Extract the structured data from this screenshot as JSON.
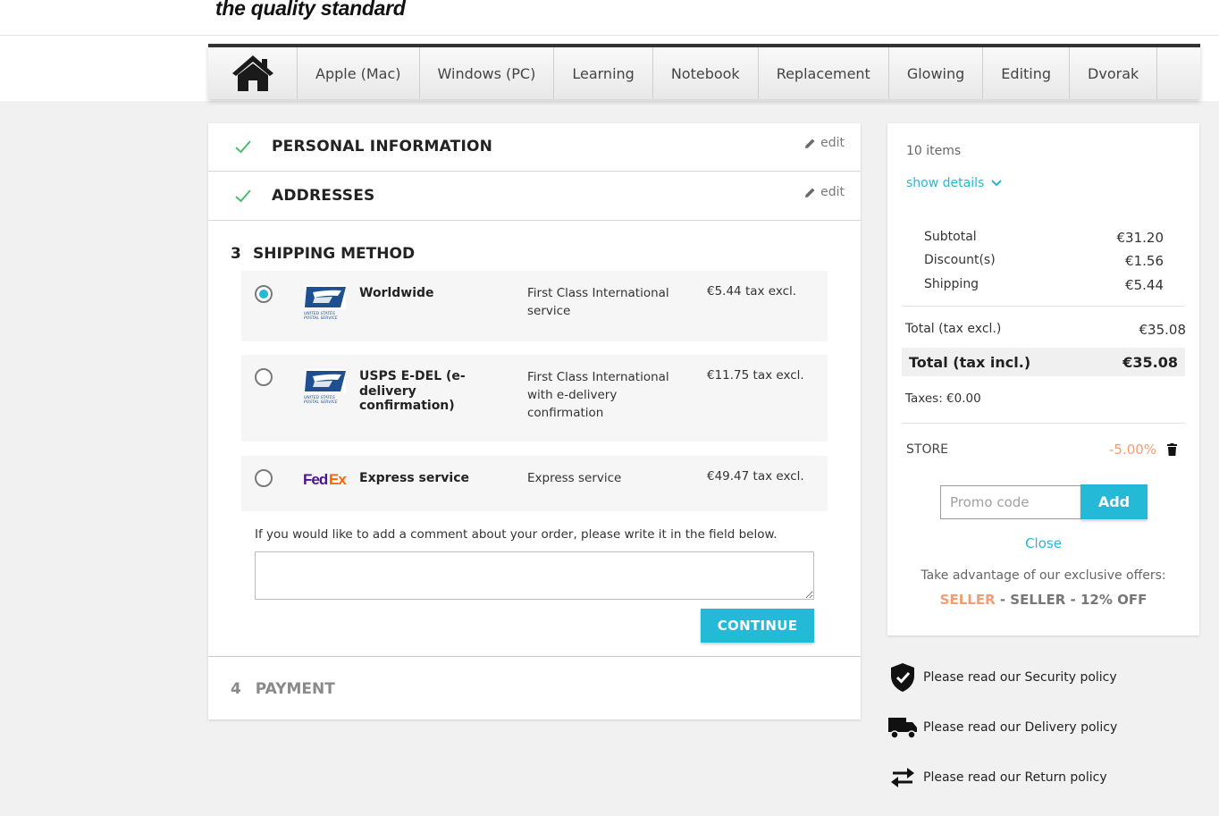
{
  "header": {
    "tagline": "the quality standard"
  },
  "nav": {
    "home_icon": "home-icon",
    "items": [
      "Apple (Mac)",
      "Windows (PC)",
      "Learning",
      "Notebook",
      "Replacement",
      "Glowing",
      "Editing",
      "Dvorak"
    ]
  },
  "checkout": {
    "steps": [
      {
        "title": "PERSONAL INFORMATION",
        "edit": "edit",
        "status": "complete"
      },
      {
        "title": "ADDRESSES",
        "edit": "edit",
        "status": "complete"
      }
    ],
    "shipping": {
      "number": "3",
      "title": "SHIPPING METHOD",
      "selected_index": 0,
      "options": [
        {
          "logo": "USPS",
          "logo_text": "UNITED STATES POSTAL SERVICE",
          "name": "Worldwide",
          "delay": "First Class International service",
          "price": "€5.44 tax excl."
        },
        {
          "logo": "USPS",
          "logo_text": "UNITED STATES POSTAL SERVICE",
          "name": "USPS E-DEL (e-delivery confirmation)",
          "delay": "First Class International with e-delivery confirmation",
          "price": "€11.75 tax excl."
        },
        {
          "logo": "FedEx",
          "name": "Express service",
          "delay": "Express service",
          "price": "€49.47 tax excl."
        }
      ],
      "comment_label": "If you would like to add a comment about your order, please write it in the field below.",
      "comment_value": "",
      "continue_label": "CONTINUE"
    },
    "payment": {
      "number": "4",
      "title": "PAYMENT"
    }
  },
  "summary": {
    "items_count": "10 items",
    "show_details": "show details",
    "lines": [
      {
        "label": "Subtotal",
        "value": "€31.20"
      },
      {
        "label": "Discount(s)",
        "value": "€1.56"
      },
      {
        "label": "Shipping",
        "value": "€5.44"
      }
    ],
    "total_excl_label": "Total (tax excl.)",
    "total_excl_value": "€35.08",
    "total_incl_label": "Total (tax incl.)",
    "total_incl_value": "€35.08",
    "taxes": "Taxes: €0.00",
    "voucher_name": "STORE",
    "voucher_value": "-5.00%",
    "promo_placeholder": "Promo code",
    "promo_add": "Add",
    "close": "Close",
    "offers_text": "Take advantage of our exclusive offers:",
    "offer_code": "SELLER",
    "offer_desc": " - SELLER - 12% OFF"
  },
  "reassurance": [
    {
      "icon": "shield-check-icon",
      "text": "Please read our Security policy"
    },
    {
      "icon": "truck-icon",
      "text": "Please read our Delivery policy"
    },
    {
      "icon": "swap-arrows-icon",
      "text": "Please read our Return policy"
    }
  ],
  "colors": {
    "accent": "#24b9d7",
    "check": "#4cbb6c",
    "voucher": "#f39d72",
    "nav_border": "#333333"
  }
}
